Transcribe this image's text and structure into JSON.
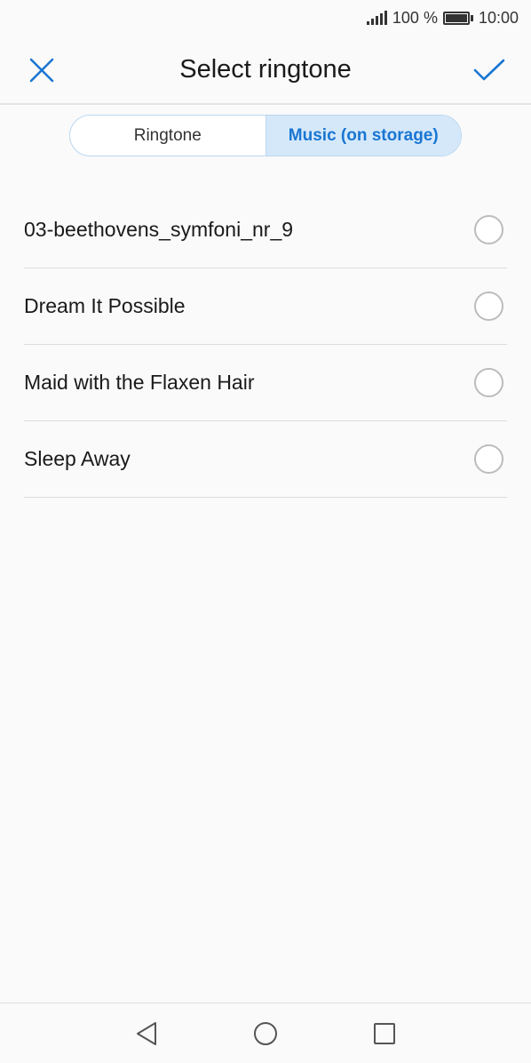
{
  "status_bar": {
    "battery_percent": "100 %",
    "time": "10:00",
    "battery_level": 1.0
  },
  "header": {
    "title": "Select ringtone",
    "close_icon": "close-icon",
    "confirm_icon": "check-icon"
  },
  "tabs": [
    {
      "label": "Ringtone",
      "active": false
    },
    {
      "label": "Music (on storage)",
      "active": true
    }
  ],
  "list": {
    "items": [
      {
        "label": "03-beethovens_symfoni_nr_9",
        "selected": false
      },
      {
        "label": "Dream It Possible",
        "selected": false
      },
      {
        "label": "Maid with the Flaxen Hair",
        "selected": false
      },
      {
        "label": "Sleep Away",
        "selected": false
      }
    ]
  },
  "nav_bar": {
    "back_icon": "back-triangle-icon",
    "home_icon": "home-circle-icon",
    "recents_icon": "recents-square-icon"
  },
  "colors": {
    "accent": "#1976d2",
    "tab_active_bg": "#d5e8fa",
    "tab_border": "#b9d7f2",
    "background": "#fafafa"
  }
}
